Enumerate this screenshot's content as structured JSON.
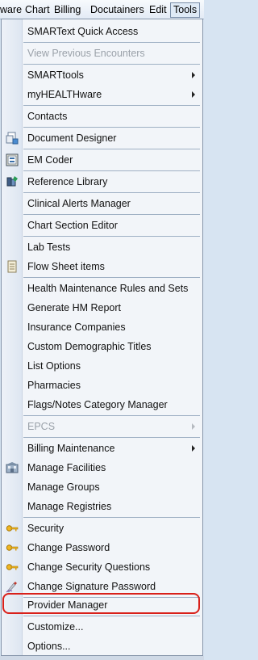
{
  "menubar": {
    "items": [
      "ware",
      "Chart",
      "Billing",
      "Docutainers",
      "Edit",
      "Tools"
    ],
    "active": "Tools"
  },
  "tools_menu": {
    "items": [
      {
        "label": "SMARText Quick Access"
      },
      {
        "label": "View Previous Encounters",
        "disabled": true
      },
      {
        "label": "SMARTtools",
        "submenu": true
      },
      {
        "label": "myHEALTHware",
        "submenu": true
      },
      {
        "label": "Contacts"
      },
      {
        "label": "Document Designer",
        "icon": "document-designer-icon"
      },
      {
        "label": "EM Coder",
        "icon": "em-coder-icon"
      },
      {
        "label": "Reference Library",
        "icon": "reference-library-icon"
      },
      {
        "label": "Clinical Alerts Manager"
      },
      {
        "label": "Chart Section Editor"
      },
      {
        "label": "Lab Tests"
      },
      {
        "label": "Flow Sheet items",
        "icon": "flow-sheet-icon"
      },
      {
        "label": "Health Maintenance Rules and Sets"
      },
      {
        "label": "Generate HM Report"
      },
      {
        "label": "Insurance Companies"
      },
      {
        "label": "Custom Demographic Titles"
      },
      {
        "label": "List Options"
      },
      {
        "label": "Pharmacies"
      },
      {
        "label": "Flags/Notes Category Manager"
      },
      {
        "label": "EPCS",
        "disabled": true,
        "submenu": true
      },
      {
        "label": "Billing Maintenance",
        "submenu": true
      },
      {
        "label": "Manage Facilities",
        "icon": "manage-facilities-icon"
      },
      {
        "label": "Manage Groups"
      },
      {
        "label": "Manage Registries"
      },
      {
        "label": "Security",
        "icon": "key-icon"
      },
      {
        "label": "Change Password",
        "icon": "key-icon"
      },
      {
        "label": "Change Security Questions",
        "icon": "key-icon"
      },
      {
        "label": "Change Signature Password",
        "icon": "signature-pen-icon"
      },
      {
        "label": "Provider Manager",
        "highlighted": true
      },
      {
        "label": "Customize..."
      },
      {
        "label": "Options..."
      }
    ]
  },
  "colors": {
    "highlight_border": "#d9201a",
    "menu_background": "#f2f5f9",
    "disabled_text": "#9aa1a9"
  }
}
